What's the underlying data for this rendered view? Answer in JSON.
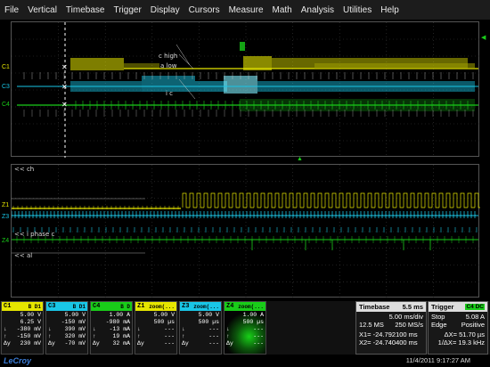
{
  "menu": [
    "File",
    "Vertical",
    "Timebase",
    "Trigger",
    "Display",
    "Cursors",
    "Measure",
    "Math",
    "Analysis",
    "Utilities",
    "Help"
  ],
  "top_grid": {
    "ch_labels": [
      "C1",
      "C3",
      "C4"
    ],
    "annotations": [
      "c high",
      "a low",
      "i c"
    ]
  },
  "bottom_grid": {
    "labels": [
      "<< ch",
      "<< i phase c",
      "<< al"
    ],
    "ch_labels": [
      "Z1",
      "Z3",
      "Z4"
    ]
  },
  "colors": {
    "c1": "#e6e600",
    "c3": "#19c6e6",
    "c4": "#19cc19",
    "grid": "#3a3a3a"
  },
  "channels": [
    {
      "id": "C1",
      "badge": "B D1",
      "color": "#e6e600",
      "lines": [
        [
          "",
          "5.00 V"
        ],
        [
          "",
          "6.25 V"
        ],
        [
          "↓",
          "-380 mV"
        ],
        [
          "↑",
          "-150 mV"
        ],
        [
          "Δy",
          "230 mV"
        ]
      ]
    },
    {
      "id": "C3",
      "badge": "B D1",
      "color": "#19c6e6",
      "lines": [
        [
          "",
          "5.00 V"
        ],
        [
          "",
          "-150 mV"
        ],
        [
          "↓",
          "390 mV"
        ],
        [
          "↑",
          "320 mV"
        ],
        [
          "Δy",
          "-70 mV"
        ]
      ]
    },
    {
      "id": "C4",
      "badge": "B D",
      "color": "#19cc19",
      "lines": [
        [
          "",
          "1.00 A"
        ],
        [
          "",
          "-980 mA"
        ],
        [
          "↓",
          "-13 mA"
        ],
        [
          "↑",
          "19 mA"
        ],
        [
          "Δy",
          "32 mA"
        ]
      ]
    },
    {
      "id": "Z1",
      "badge": "zoom(...",
      "color": "#e6e600",
      "lines": [
        [
          "",
          "5.00 V"
        ],
        [
          "",
          "500 µs"
        ],
        [
          "↓",
          "---"
        ],
        [
          "↑",
          "---"
        ],
        [
          "Δy",
          "---"
        ]
      ]
    },
    {
      "id": "Z3",
      "badge": "zoom(...",
      "color": "#19c6e6",
      "lines": [
        [
          "",
          "5.00 V"
        ],
        [
          "",
          "500 µs"
        ],
        [
          "↓",
          "---"
        ],
        [
          "↑",
          "---"
        ],
        [
          "Δy",
          "---"
        ]
      ]
    },
    {
      "id": "Z4",
      "badge": "zoom(...",
      "color": "#19cc19",
      "lines": [
        [
          "",
          "1.00 A"
        ],
        [
          "",
          "500 µs"
        ],
        [
          "↓",
          "---"
        ],
        [
          "↑",
          "---"
        ],
        [
          "Δy",
          "---"
        ]
      ]
    }
  ],
  "timebase": {
    "label": "Timebase",
    "delay": "5.5 ms",
    "div": "5.00 ms/div",
    "samples": "12.5 MS",
    "rate": "250 MS/s",
    "x1": "X1=  -24.792100 ms",
    "x2": "X2=  -24.740400 ms",
    "dx": "ΔX=  51.70 µs",
    "inv_dx": "1/ΔX=  19.3 kHz"
  },
  "trigger": {
    "label": "Trigger",
    "badge": "C4 DC",
    "mode": "Stop",
    "level": "5.08 A",
    "type": "Edge",
    "slope": "Positive"
  },
  "footer": {
    "logo": "LeCroy",
    "datetime": "11/4/2011 9:17:27 AM"
  }
}
